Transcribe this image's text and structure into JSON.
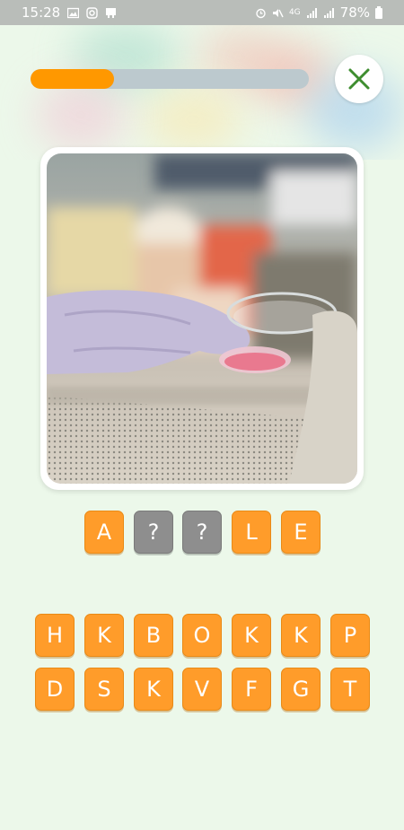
{
  "status_bar": {
    "time": "15:28",
    "battery": "78%",
    "network": "4G",
    "icons_left": [
      "gallery-icon",
      "instagram-icon",
      "notification-icon"
    ],
    "icons_right": [
      "alarm-icon",
      "mute-icon",
      "signal-icon",
      "battery-icon"
    ]
  },
  "game": {
    "progress": 0.3,
    "accent_color": "#ff9800",
    "close_icon": "close-icon",
    "photo": "gloved hand holding petri dish in lab",
    "answer_slots": [
      "A",
      "?",
      "?",
      "L",
      "E"
    ],
    "answer_hidden": [
      false,
      true,
      true,
      false,
      false
    ],
    "keyboard": {
      "row1": [
        "H",
        "K",
        "B",
        "O",
        "K",
        "K",
        "P"
      ],
      "row2": [
        "D",
        "S",
        "K",
        "V",
        "F",
        "G",
        "T"
      ]
    }
  }
}
